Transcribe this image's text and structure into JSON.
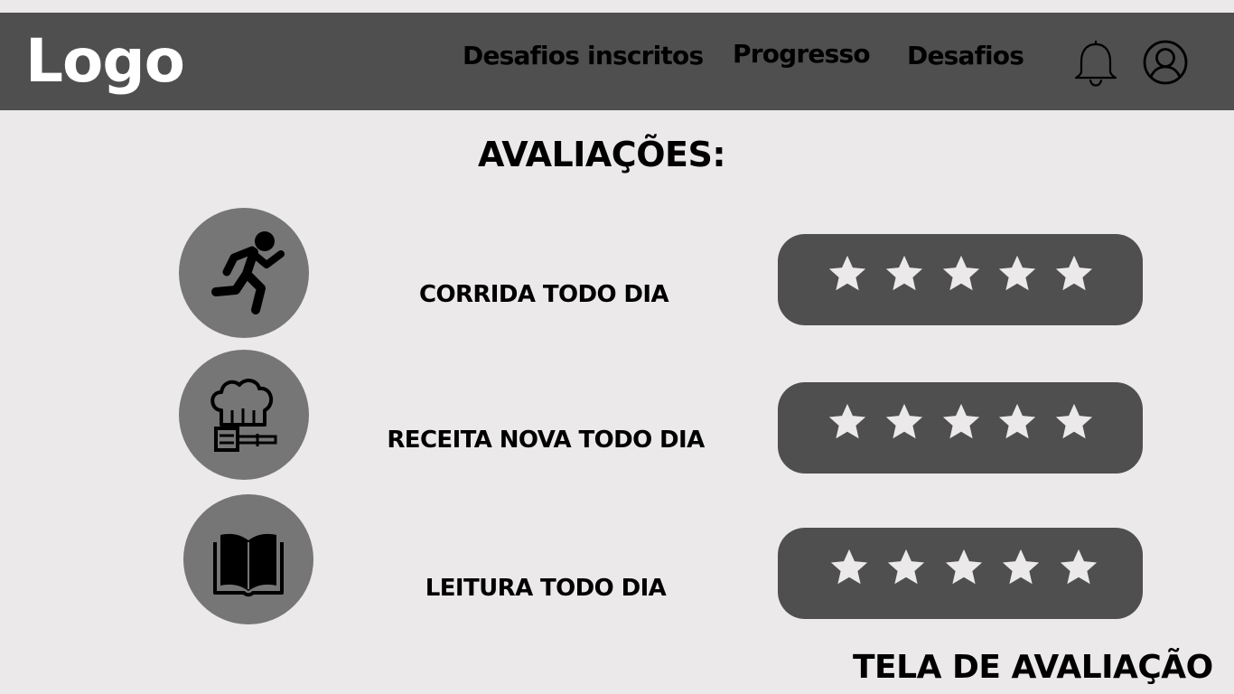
{
  "header": {
    "logo": "Logo",
    "nav": [
      {
        "label": "Desafios inscritos"
      },
      {
        "label": "Progresso"
      },
      {
        "label": "Desafios"
      }
    ],
    "icons": [
      "bell-icon",
      "user-profile-icon"
    ]
  },
  "main": {
    "title": "AVALIAÇÕES:",
    "challenges": [
      {
        "label": "CORRIDA TODO DIA",
        "icon": "running-person-icon",
        "rating": {
          "max": 5,
          "stars_shown": 5
        }
      },
      {
        "label": "RECEITA NOVA TODO DIA",
        "icon": "chef-hat-spatula-icon",
        "rating": {
          "max": 5,
          "stars_shown": 5
        }
      },
      {
        "label": "LEITURA TODO DIA",
        "icon": "open-book-icon",
        "rating": {
          "max": 5,
          "stars_shown": 5
        }
      }
    ]
  },
  "footer": {
    "title": "TELA DE AVALIAÇÃO"
  },
  "colors": {
    "background": "#ebe9ea",
    "header": "#4f4f4f",
    "icon_circle": "#767676",
    "rating_panel": "#4f4f4f",
    "star": "#ebe9ea",
    "text": "#000000",
    "logo": "#ffffff"
  }
}
